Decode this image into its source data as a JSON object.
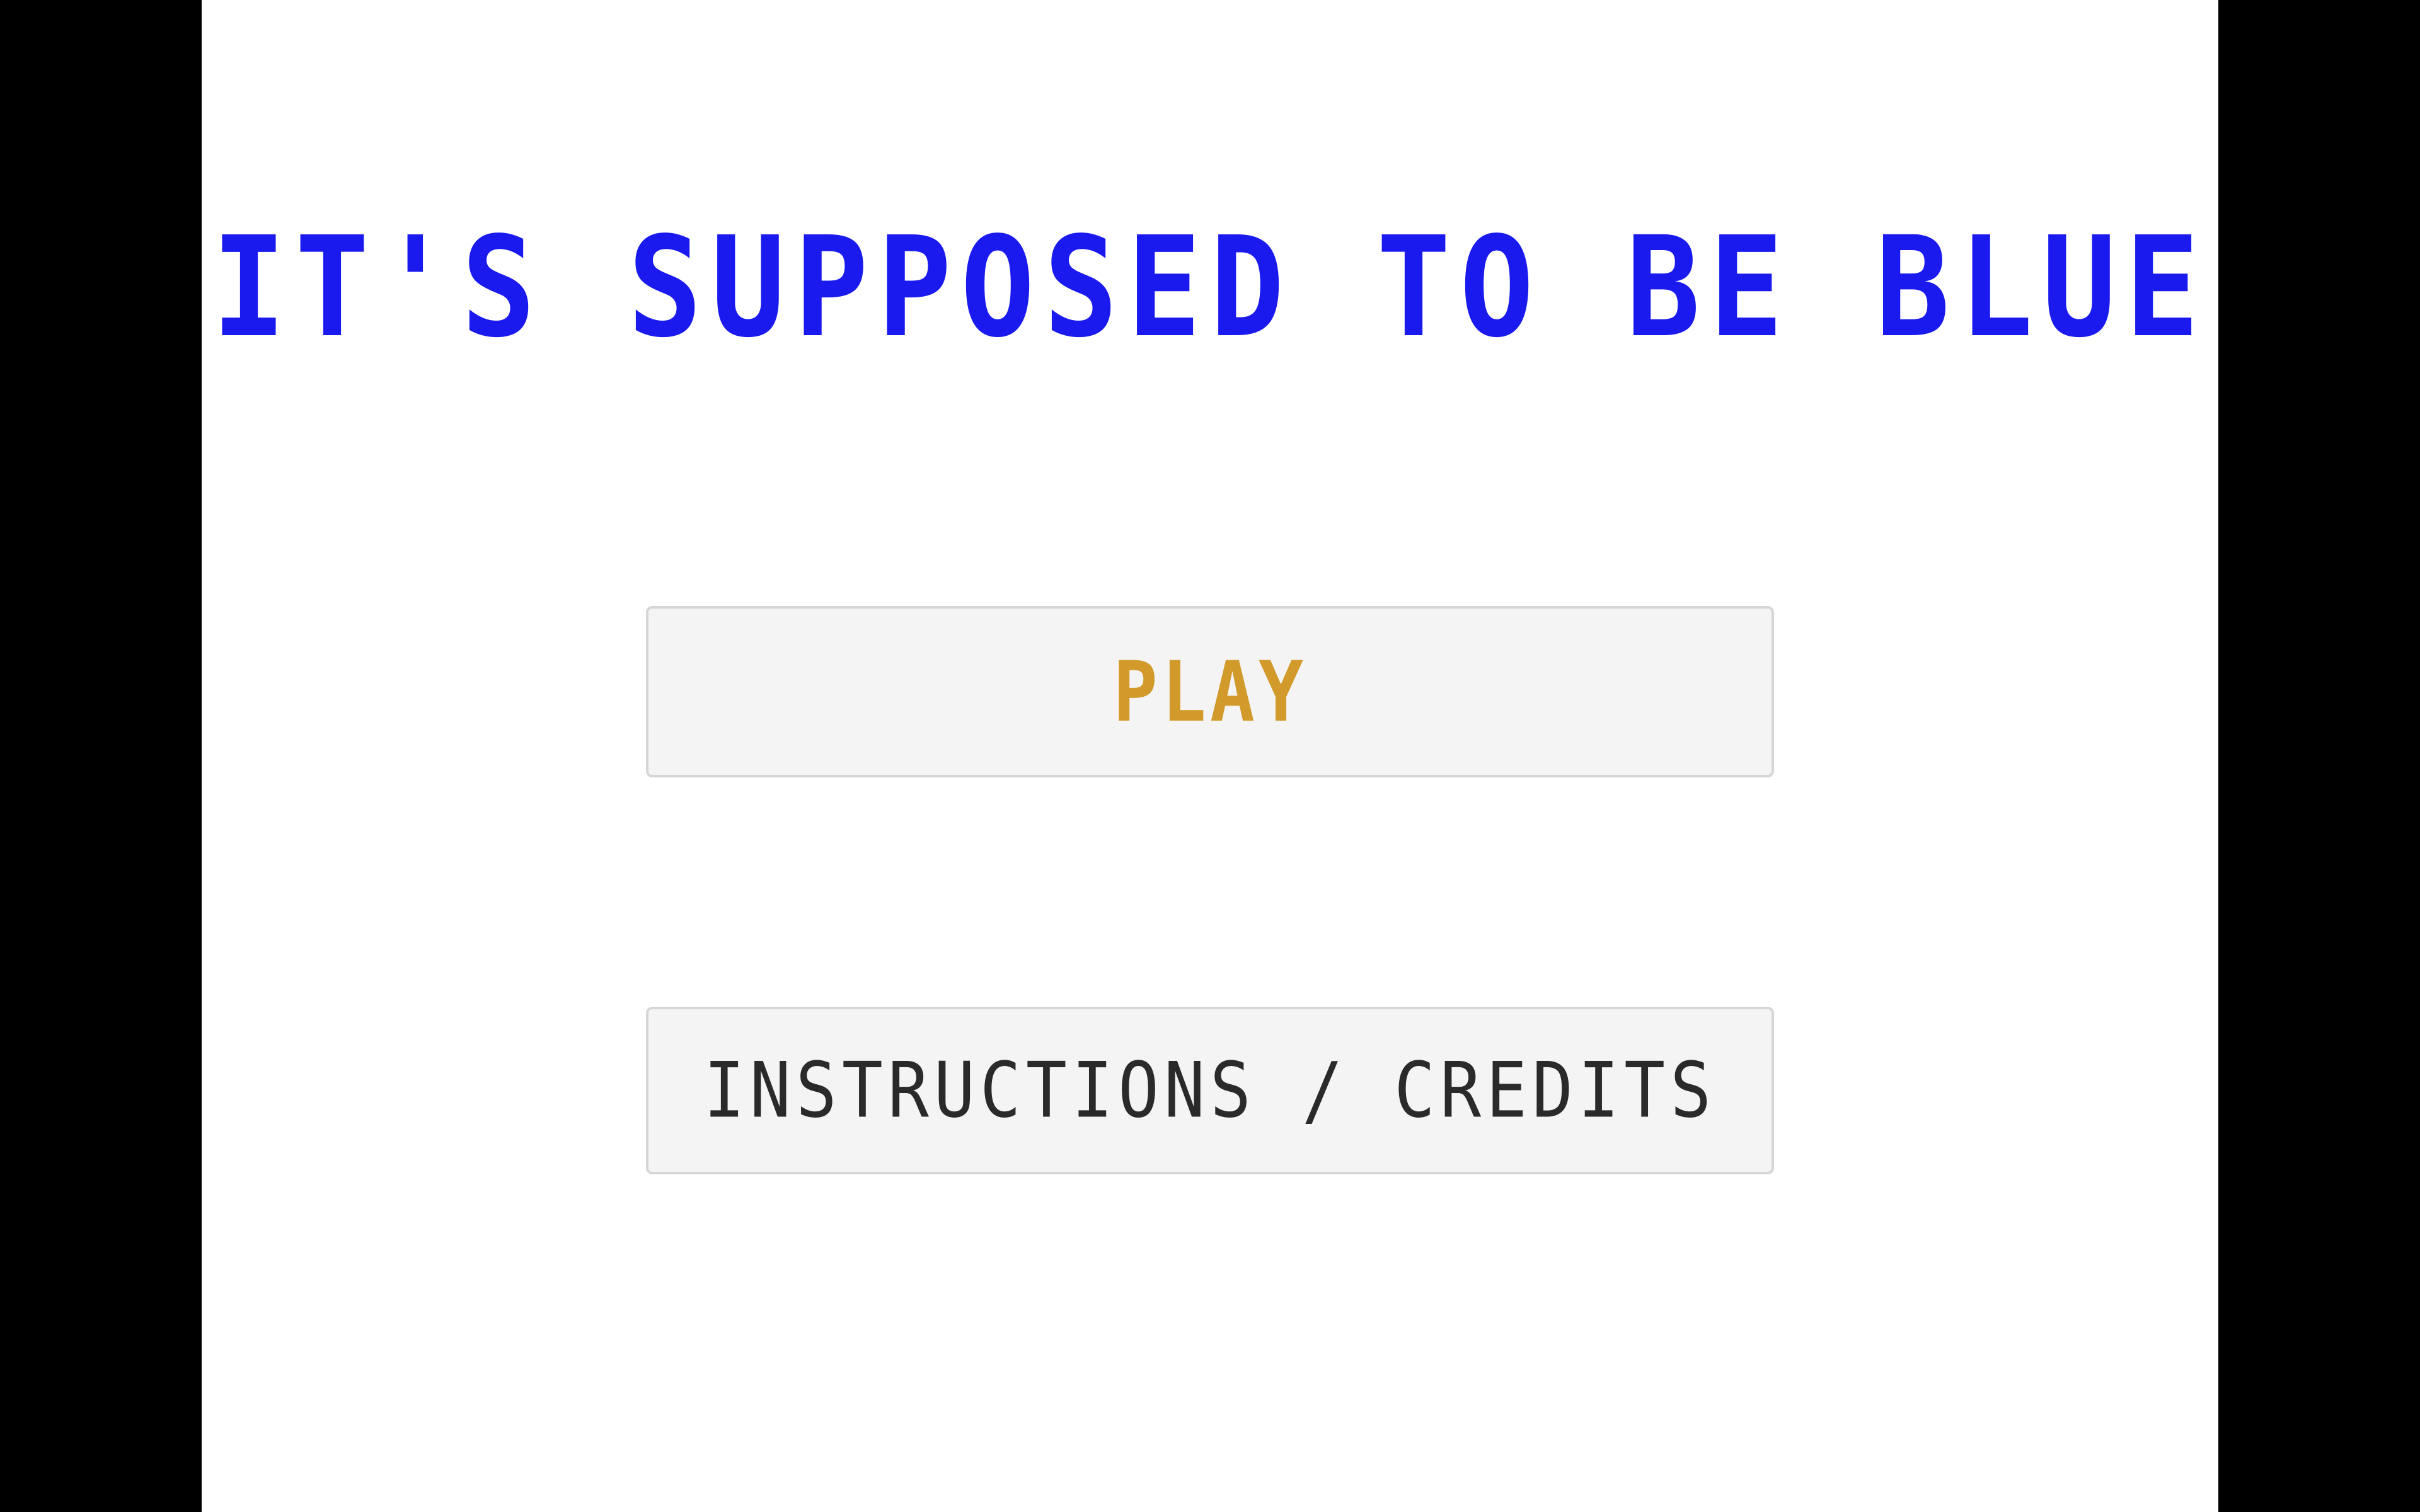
{
  "game": {
    "title": "IT'S SUPPOSED TO BE BLUE",
    "title_color": "#1a1aee",
    "background_color": "#ffffff",
    "letterbox_color": "#000000"
  },
  "menu": {
    "play_label": "PLAY",
    "play_color": "#d19a2a",
    "instructions_label": "INSTRUCTIONS / CREDITS",
    "instructions_color": "#2a2a2a",
    "button_background": "#f4f4f4",
    "button_border": "#d6d6d6"
  }
}
